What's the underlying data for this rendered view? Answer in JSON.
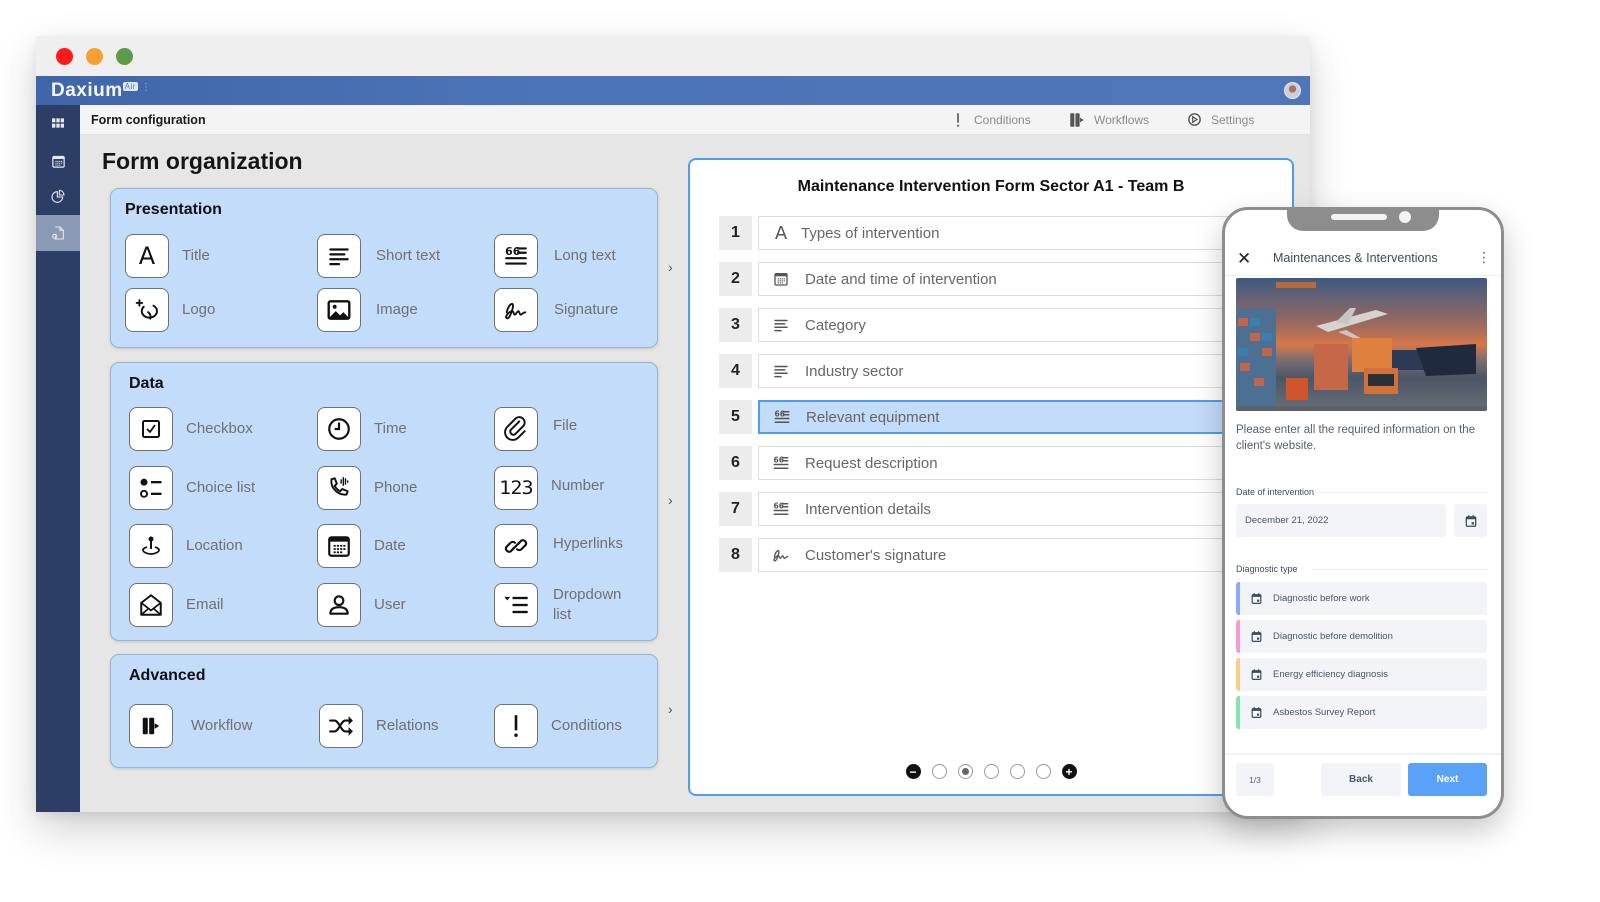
{
  "window": {
    "app_name": "Daxium",
    "app_badge": "Air",
    "subbar_title": "Form configuration",
    "actions": [
      {
        "label": "Conditions",
        "icon": "exclamation-icon"
      },
      {
        "label": "Workflows",
        "icon": "workflow-icon"
      },
      {
        "label": "Settings",
        "icon": "settings-icon"
      }
    ],
    "sidenav": [
      {
        "name": "apps-grid",
        "icon": "grid-icon",
        "active": false
      },
      {
        "name": "calendar",
        "icon": "calendar-icon",
        "active": false
      },
      {
        "name": "reports",
        "icon": "pie-chart-icon",
        "active": false
      },
      {
        "name": "forms",
        "icon": "form-document-icon",
        "active": true
      }
    ]
  },
  "page_title": "Form organization",
  "groups": {
    "presentation": {
      "title": "Presentation",
      "items": [
        {
          "label": "Title",
          "icon": "title-letter-icon"
        },
        {
          "label": "Short text",
          "icon": "short-text-icon"
        },
        {
          "label": "Long text",
          "icon": "long-text-icon"
        },
        {
          "label": "Logo",
          "icon": "logo-icon"
        },
        {
          "label": "Image",
          "icon": "image-icon"
        },
        {
          "label": "Signature",
          "icon": "signature-icon"
        }
      ]
    },
    "data": {
      "title": "Data",
      "items": [
        {
          "label": "Checkbox",
          "icon": "checkbox-icon"
        },
        {
          "label": "Time",
          "icon": "clock-icon"
        },
        {
          "label": "File",
          "icon": "paperclip-icon"
        },
        {
          "label": "Choice list",
          "icon": "choice-list-icon"
        },
        {
          "label": "Phone",
          "icon": "phone-icon"
        },
        {
          "label": "Number",
          "icon": "number-icon",
          "glyph": "123"
        },
        {
          "label": "Location",
          "icon": "location-pin-icon"
        },
        {
          "label": "Date",
          "icon": "calendar-icon"
        },
        {
          "label": "Hyperlinks",
          "icon": "link-icon"
        },
        {
          "label": "Email",
          "icon": "email-icon"
        },
        {
          "label": "User",
          "icon": "user-icon"
        },
        {
          "label": "Dropdown list",
          "icon": "dropdown-list-icon"
        }
      ]
    },
    "advanced": {
      "title": "Advanced",
      "items": [
        {
          "label": "Workflow",
          "icon": "workflow-icon"
        },
        {
          "label": "Relations",
          "icon": "shuffle-icon"
        },
        {
          "label": "Conditions",
          "icon": "exclamation-icon"
        }
      ]
    }
  },
  "form": {
    "title": "Maintenance Intervention Form Sector A1 - Team B",
    "rows": [
      {
        "num": "1",
        "label": "Types of intervention",
        "icon": "title-letter-icon",
        "selected": false
      },
      {
        "num": "2",
        "label": "Date and time of intervention",
        "icon": "calendar-icon",
        "selected": false
      },
      {
        "num": "3",
        "label": "Category",
        "icon": "short-text-icon",
        "selected": false
      },
      {
        "num": "4",
        "label": "Industry sector",
        "icon": "short-text-icon",
        "selected": false
      },
      {
        "num": "5",
        "label": "Relevant equipment",
        "icon": "long-text-icon",
        "selected": true
      },
      {
        "num": "6",
        "label": "Request description",
        "icon": "long-text-icon",
        "selected": false
      },
      {
        "num": "7",
        "label": "Intervention details",
        "icon": "long-text-icon",
        "selected": false
      },
      {
        "num": "8",
        "label": "Customer's signature",
        "icon": "signature-icon",
        "selected": false
      }
    ],
    "pager": {
      "total_pages": 5,
      "current_page": 2
    }
  },
  "phone": {
    "title": "Maintenances & Interventions",
    "description": "Please enter all the required information on the client's website.",
    "date_label": "Date of intervention",
    "date_value": "December 21, 2022",
    "diagnostic_label": "Diagnostic type",
    "options": [
      {
        "label": "Diagnostic before work",
        "color": "#8fa8f5"
      },
      {
        "label": "Diagnostic before demolition",
        "color": "#f59ad8"
      },
      {
        "label": "Energy efficiency diagnosis",
        "color": "#f8cf8a"
      },
      {
        "label": "Asbestos Survey Report",
        "color": "#86e3b4"
      }
    ],
    "page_indicator": "1/3",
    "back_label": "Back",
    "next_label": "Next"
  },
  "colors": {
    "accent": "#4f9cf0",
    "group_bg": "#c3dcfa",
    "nav_bg": "#2c3e66",
    "appbar": "#4c74b8",
    "next_button": "#5aa2f7"
  }
}
